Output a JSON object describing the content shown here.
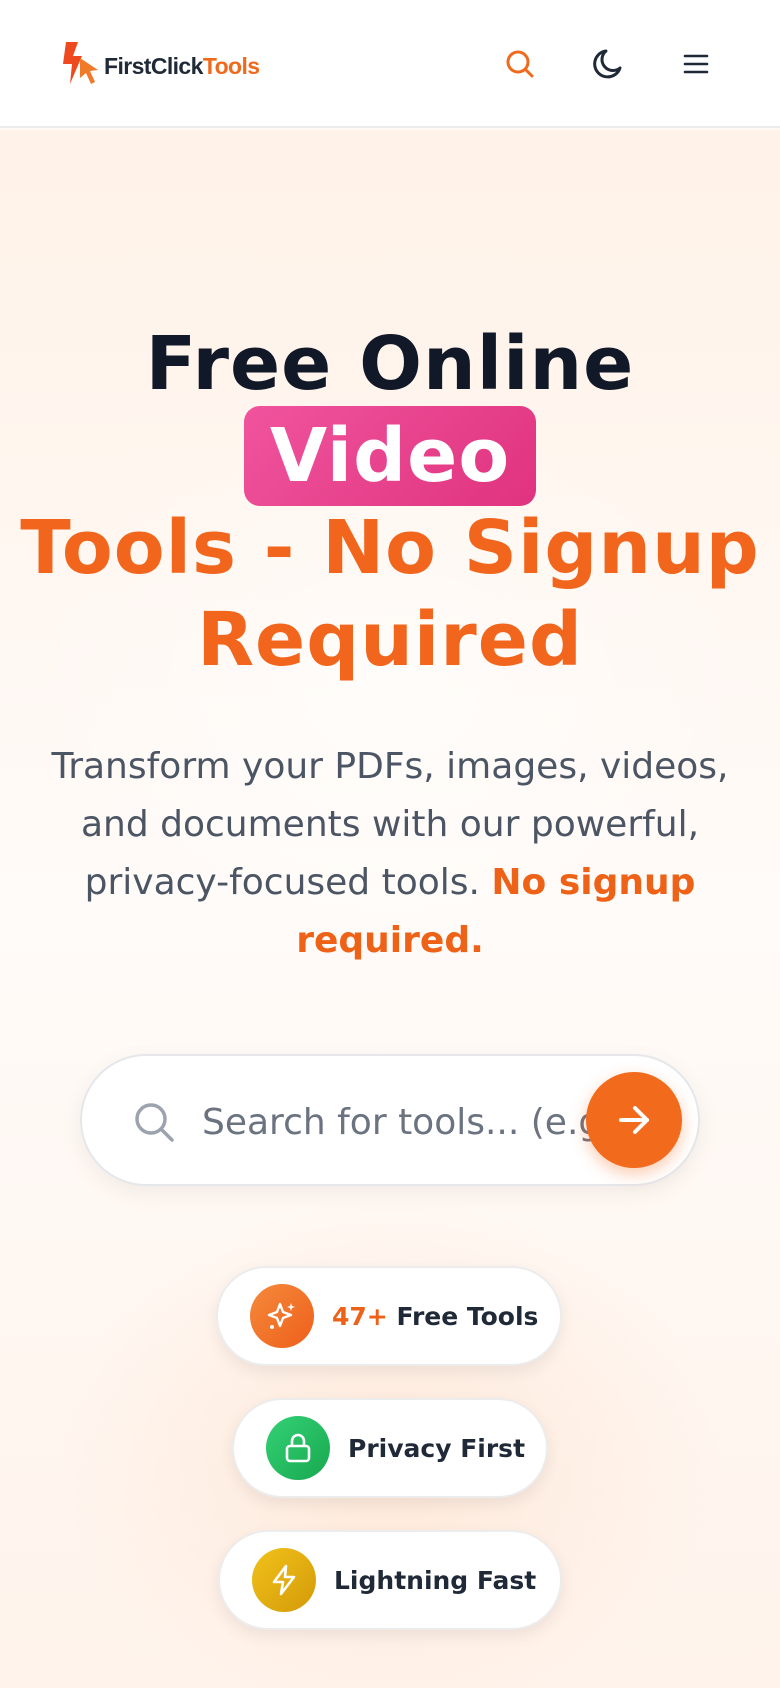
{
  "header": {
    "brand_part1": "FirstClick",
    "brand_part2": "Tools",
    "icons": [
      "logo-icon",
      "search-icon",
      "moon-icon",
      "menu-icon"
    ]
  },
  "hero": {
    "title_line1": "Free Online",
    "title_highlight": "Video",
    "title_line3": "Tools - No Signup Required",
    "subtitle": "Transform your PDFs, images, videos, and documents with our powerful, privacy-focused tools.",
    "subtitle_highlight": "No signup required."
  },
  "search": {
    "placeholder": "Search for tools... (e.g., PDF to Word)",
    "icons": [
      "search-icon",
      "arrow-right-icon"
    ]
  },
  "features": [
    {
      "prefix": "47+",
      "label": "Free Tools",
      "icon": "sparkles-icon"
    },
    {
      "prefix": "",
      "label": "Privacy First",
      "icon": "lock-icon"
    },
    {
      "prefix": "",
      "label": "Lightning Fast",
      "icon": "lightning-icon"
    }
  ],
  "colors": {
    "accent": "#f26b1d",
    "highlight_pink": "#e8418c",
    "heading": "#111827",
    "body_text": "#4b5563",
    "green": "#22c55e",
    "gold": "#eab308"
  }
}
